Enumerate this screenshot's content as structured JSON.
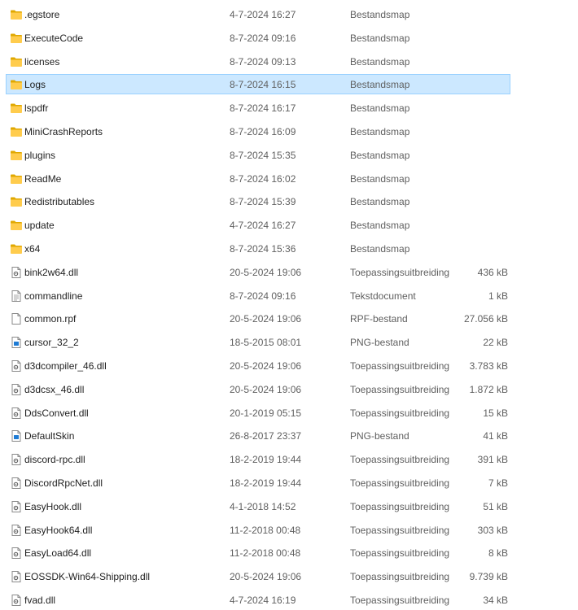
{
  "files": [
    {
      "name": ".egstore",
      "date": "4-7-2024 16:27",
      "type": "Bestandsmap",
      "size": "",
      "icon": "folder-icon"
    },
    {
      "name": "ExecuteCode",
      "date": "8-7-2024 09:16",
      "type": "Bestandsmap",
      "size": "",
      "icon": "folder-icon"
    },
    {
      "name": "licenses",
      "date": "8-7-2024 09:13",
      "type": "Bestandsmap",
      "size": "",
      "icon": "folder-icon"
    },
    {
      "name": "Logs",
      "date": "8-7-2024 16:15",
      "type": "Bestandsmap",
      "size": "",
      "icon": "folder-icon",
      "selected": true
    },
    {
      "name": "lspdfr",
      "date": "8-7-2024 16:17",
      "type": "Bestandsmap",
      "size": "",
      "icon": "folder-icon"
    },
    {
      "name": "MiniCrashReports",
      "date": "8-7-2024 16:09",
      "type": "Bestandsmap",
      "size": "",
      "icon": "folder-icon"
    },
    {
      "name": "plugins",
      "date": "8-7-2024 15:35",
      "type": "Bestandsmap",
      "size": "",
      "icon": "folder-icon"
    },
    {
      "name": "ReadMe",
      "date": "8-7-2024 16:02",
      "type": "Bestandsmap",
      "size": "",
      "icon": "folder-icon"
    },
    {
      "name": "Redistributables",
      "date": "8-7-2024 15:39",
      "type": "Bestandsmap",
      "size": "",
      "icon": "folder-icon"
    },
    {
      "name": "update",
      "date": "4-7-2024 16:27",
      "type": "Bestandsmap",
      "size": "",
      "icon": "folder-icon"
    },
    {
      "name": "x64",
      "date": "8-7-2024 15:36",
      "type": "Bestandsmap",
      "size": "",
      "icon": "folder-icon"
    },
    {
      "name": "bink2w64.dll",
      "date": "20-5-2024 19:06",
      "type": "Toepassingsuitbreiding",
      "size": "436 kB",
      "icon": "dll-file-icon"
    },
    {
      "name": "commandline",
      "date": "8-7-2024 09:16",
      "type": "Tekstdocument",
      "size": "1 kB",
      "icon": "text-file-icon"
    },
    {
      "name": "common.rpf",
      "date": "20-5-2024 19:06",
      "type": "RPF-bestand",
      "size": "27.056 kB",
      "icon": "blank-file-icon"
    },
    {
      "name": "cursor_32_2",
      "date": "18-5-2015 08:01",
      "type": "PNG-bestand",
      "size": "22 kB",
      "icon": "image-file-icon"
    },
    {
      "name": "d3dcompiler_46.dll",
      "date": "20-5-2024 19:06",
      "type": "Toepassingsuitbreiding",
      "size": "3.783 kB",
      "icon": "dll-file-icon"
    },
    {
      "name": "d3dcsx_46.dll",
      "date": "20-5-2024 19:06",
      "type": "Toepassingsuitbreiding",
      "size": "1.872 kB",
      "icon": "dll-file-icon"
    },
    {
      "name": "DdsConvert.dll",
      "date": "20-1-2019 05:15",
      "type": "Toepassingsuitbreiding",
      "size": "15 kB",
      "icon": "dll-file-icon"
    },
    {
      "name": "DefaultSkin",
      "date": "26-8-2017 23:37",
      "type": "PNG-bestand",
      "size": "41 kB",
      "icon": "image-file-icon"
    },
    {
      "name": "discord-rpc.dll",
      "date": "18-2-2019 19:44",
      "type": "Toepassingsuitbreiding",
      "size": "391 kB",
      "icon": "dll-file-icon"
    },
    {
      "name": "DiscordRpcNet.dll",
      "date": "18-2-2019 19:44",
      "type": "Toepassingsuitbreiding",
      "size": "7 kB",
      "icon": "dll-file-icon"
    },
    {
      "name": "EasyHook.dll",
      "date": "4-1-2018 14:52",
      "type": "Toepassingsuitbreiding",
      "size": "51 kB",
      "icon": "dll-file-icon"
    },
    {
      "name": "EasyHook64.dll",
      "date": "11-2-2018 00:48",
      "type": "Toepassingsuitbreiding",
      "size": "303 kB",
      "icon": "dll-file-icon"
    },
    {
      "name": "EasyLoad64.dll",
      "date": "11-2-2018 00:48",
      "type": "Toepassingsuitbreiding",
      "size": "8 kB",
      "icon": "dll-file-icon"
    },
    {
      "name": "EOSSDK-Win64-Shipping.dll",
      "date": "20-5-2024 19:06",
      "type": "Toepassingsuitbreiding",
      "size": "9.739 kB",
      "icon": "dll-file-icon"
    },
    {
      "name": "fvad.dll",
      "date": "4-7-2024 16:19",
      "type": "Toepassingsuitbreiding",
      "size": "34 kB",
      "icon": "dll-file-icon"
    }
  ]
}
